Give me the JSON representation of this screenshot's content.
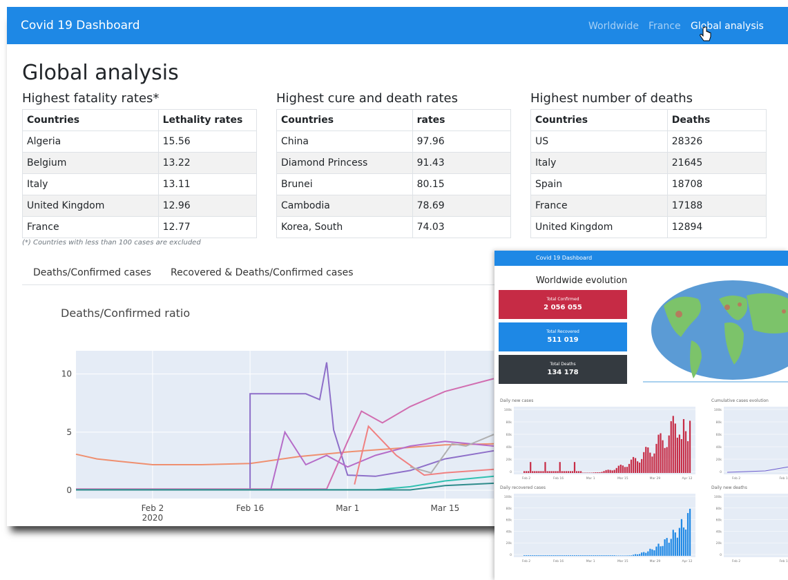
{
  "navbar": {
    "brand": "Covid 19 Dashboard",
    "links": [
      "Worldwide",
      "France",
      "Global analysis"
    ],
    "active": "Global analysis",
    "color": "#1e88e5"
  },
  "page_title": "Global analysis",
  "tables": {
    "fatality": {
      "title": "Highest fatality rates*",
      "headers": [
        "Countries",
        "Lethality rates"
      ],
      "rows": [
        [
          "Algeria",
          "15.56"
        ],
        [
          "Belgium",
          "13.22"
        ],
        [
          "Italy",
          "13.11"
        ],
        [
          "United Kingdom",
          "12.96"
        ],
        [
          "France",
          "12.77"
        ]
      ]
    },
    "cure_death": {
      "title": "Highest cure and death rates",
      "headers": [
        "Countries",
        "rates"
      ],
      "rows": [
        [
          "China",
          "97.96"
        ],
        [
          "Diamond Princess",
          "91.43"
        ],
        [
          "Brunei",
          "80.15"
        ],
        [
          "Cambodia",
          "78.69"
        ],
        [
          "Korea, South",
          "74.03"
        ]
      ]
    },
    "deaths": {
      "title": "Highest number of deaths",
      "headers": [
        "Countries",
        "Deaths"
      ],
      "rows": [
        [
          "US",
          "28326"
        ],
        [
          "Italy",
          "21645"
        ],
        [
          "Spain",
          "18708"
        ],
        [
          "France",
          "17188"
        ],
        [
          "United Kingdom",
          "12894"
        ]
      ]
    },
    "note": "(*) Countries with less than 100 cases are excluded"
  },
  "tabs": [
    "Deaths/Confirmed cases",
    "Recovered & Deaths/Confirmed cases"
  ],
  "chart_data": {
    "type": "line",
    "title": "Deaths/Confirmed ratio",
    "x_ticks": [
      "Feb 2\n2020",
      "Feb 16",
      "Mar 1",
      "Mar 15"
    ],
    "y_ticks": [
      0,
      5,
      10
    ],
    "ylim": [
      0,
      12
    ],
    "xlim": [
      "2020-01-22",
      "2020-03-22"
    ],
    "series": [
      {
        "color": "#ef8f6f",
        "x": [
          "2020-01-22",
          "2020-01-25",
          "2020-01-28",
          "2020-02-02",
          "2020-02-09",
          "2020-02-16",
          "2020-02-23",
          "2020-03-01",
          "2020-03-08",
          "2020-03-15",
          "2020-03-22"
        ],
        "y": [
          3.1,
          2.7,
          2.5,
          2.2,
          2.2,
          2.3,
          2.9,
          3.3,
          3.6,
          3.9,
          4.0
        ]
      },
      {
        "color": "#8e6fc9",
        "x": [
          "2020-02-16",
          "2020-02-16",
          "2020-02-24",
          "2020-02-26",
          "2020-02-27",
          "2020-02-28",
          "2020-03-01",
          "2020-03-05",
          "2020-03-10",
          "2020-03-15",
          "2020-03-22"
        ],
        "y": [
          0,
          8.3,
          8.3,
          7.8,
          11.0,
          5.2,
          1.3,
          1.2,
          1.7,
          2.7,
          3.4
        ]
      },
      {
        "color": "#d16db0",
        "x": [
          "2020-01-22",
          "2020-02-27",
          "2020-03-01",
          "2020-03-03",
          "2020-03-06",
          "2020-03-10",
          "2020-03-15",
          "2020-03-22"
        ],
        "y": [
          0.1,
          0.1,
          4.2,
          6.8,
          5.8,
          7.2,
          8.5,
          9.6
        ]
      },
      {
        "color": "#b56cc8",
        "x": [
          "2020-02-19",
          "2020-02-21",
          "2020-02-24",
          "2020-02-27",
          "2020-03-01",
          "2020-03-05",
          "2020-03-10",
          "2020-03-15",
          "2020-03-22"
        ],
        "y": [
          0.1,
          5.0,
          2.2,
          3.0,
          2.0,
          3.0,
          3.8,
          4.2,
          3.8
        ]
      },
      {
        "color": "#f08080",
        "x": [
          "2020-03-02",
          "2020-03-04",
          "2020-03-08",
          "2020-03-12",
          "2020-03-15",
          "2020-03-22"
        ],
        "y": [
          0.5,
          5.5,
          3.0,
          1.3,
          1.5,
          1.8
        ]
      },
      {
        "color": "#b0b0b0",
        "x": [
          "2020-03-10",
          "2020-03-13",
          "2020-03-16",
          "2020-03-18",
          "2020-03-22"
        ],
        "y": [
          2.0,
          1.5,
          4.0,
          3.8,
          4.8
        ]
      },
      {
        "color": "#30c0b0",
        "x": [
          "2020-01-22",
          "2020-03-05",
          "2020-03-10",
          "2020-03-15",
          "2020-03-22"
        ],
        "y": [
          0.05,
          0.05,
          0.3,
          0.8,
          1.2
        ]
      },
      {
        "color": "#2e8b8b",
        "x": [
          "2020-01-22",
          "2020-03-10",
          "2020-03-15",
          "2020-03-22"
        ],
        "y": [
          0.03,
          0.03,
          0.4,
          0.6
        ]
      }
    ]
  },
  "inset": {
    "brand": "Covid 19 Dashboard",
    "title": "Worldwide evolution",
    "cards": [
      {
        "label": "Total Confirmed",
        "value": "2 056 055",
        "color": "#c62b45"
      },
      {
        "label": "Total Recovered",
        "value": "511 019",
        "color": "#1e88e5"
      },
      {
        "label": "Total Deaths",
        "value": "134 178",
        "color": "#343a40"
      }
    ],
    "chart_titles": [
      "Daily new cases",
      "Cumulative cases evolution",
      "Daily recovered cases",
      "Daily new deaths"
    ],
    "axis_ticks": {
      "x": [
        "Feb 2\n2020",
        "Feb 16",
        "Mar 1",
        "Mar 15",
        "Mar 29",
        "Apr 12"
      ],
      "y_cases": [
        "100k",
        "80k",
        "60k",
        "40k",
        "20k",
        "0"
      ]
    }
  }
}
